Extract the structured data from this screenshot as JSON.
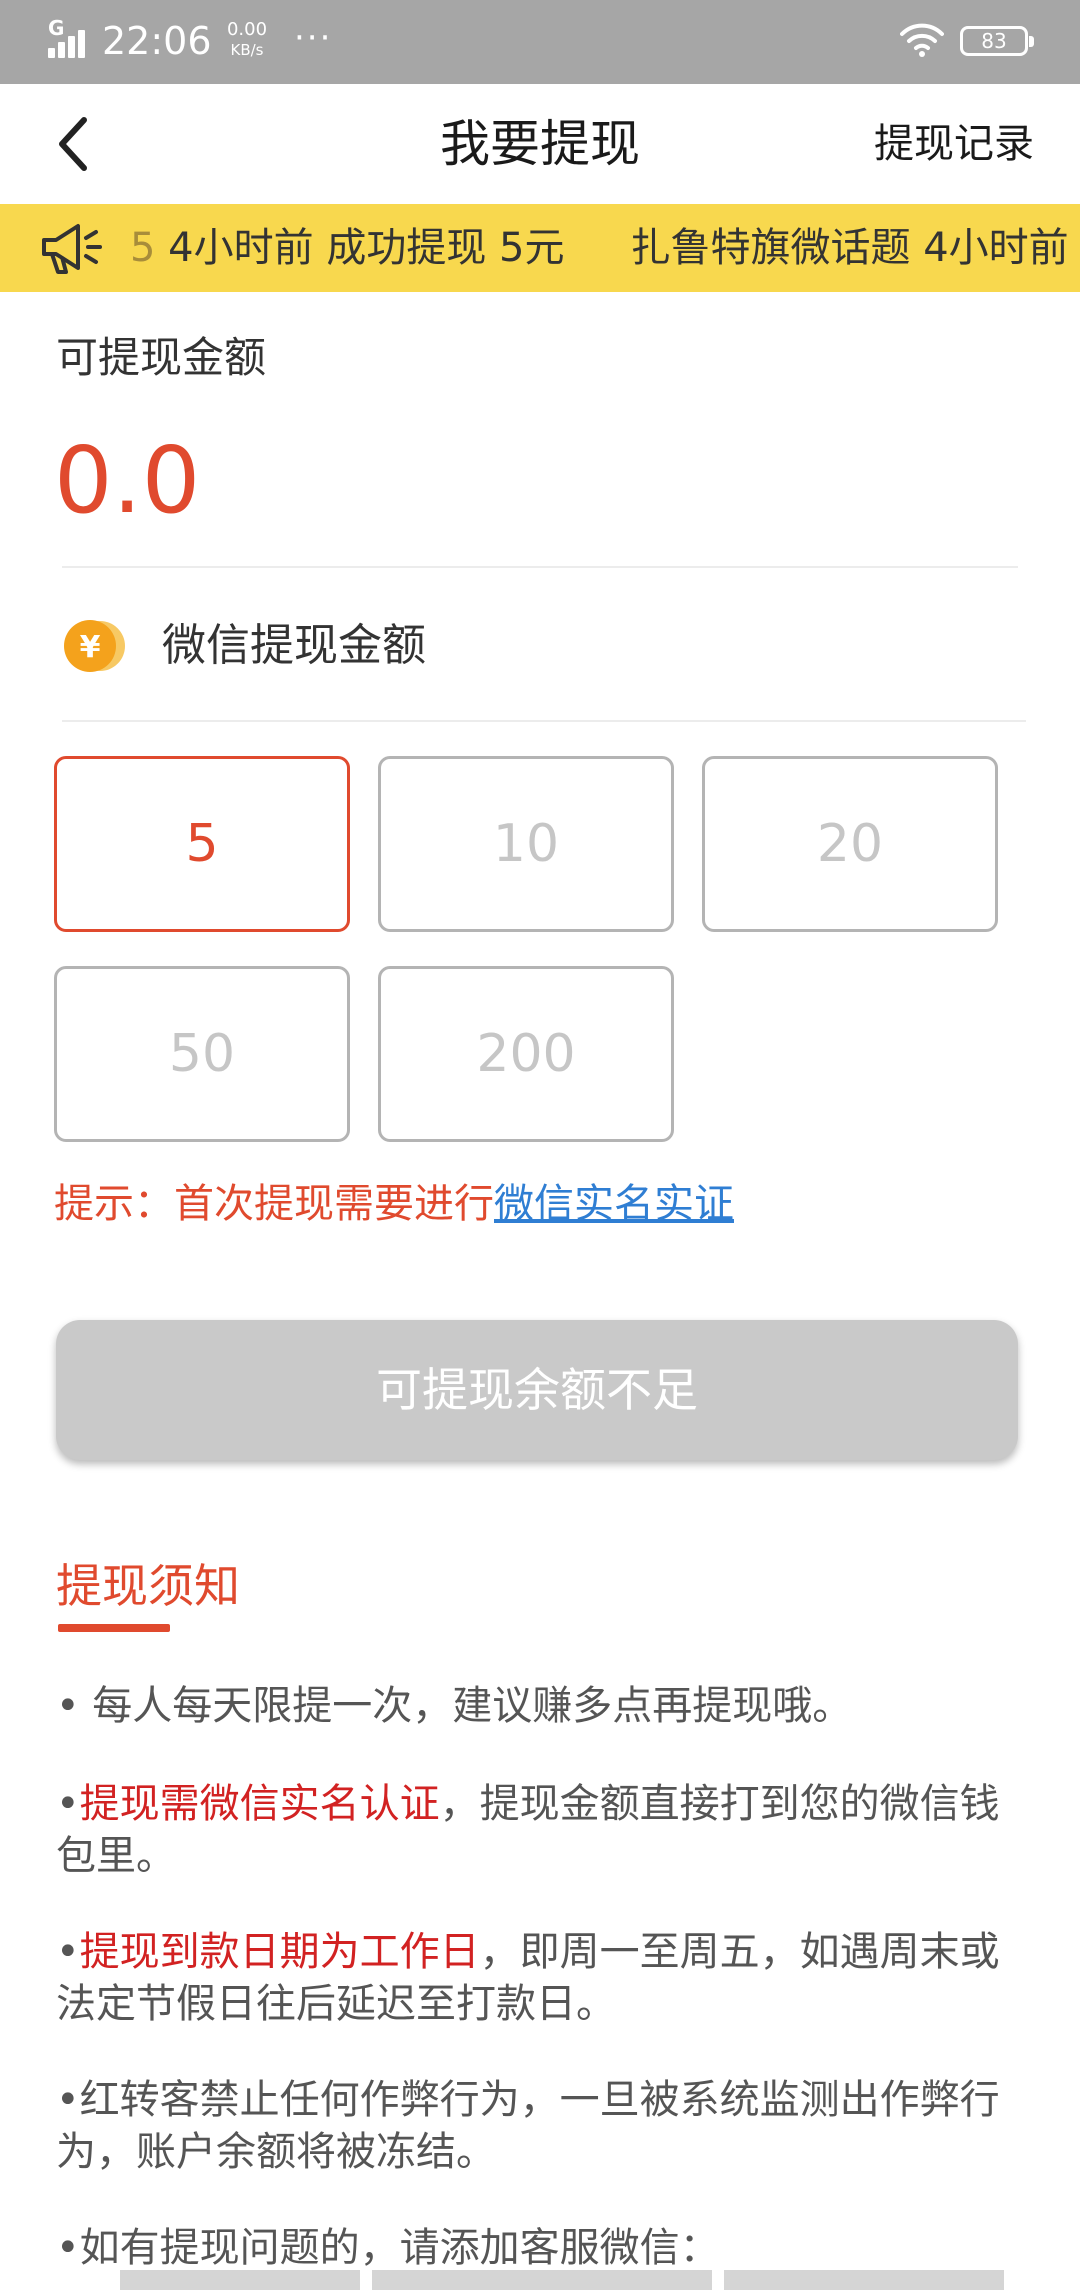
{
  "status_bar": {
    "network": "G",
    "time": "22:06",
    "speed_value": "0.00",
    "speed_unit": "KB/s",
    "more": "···",
    "battery": "83"
  },
  "header": {
    "title": "我要提现",
    "record_link": "提现记录"
  },
  "notice": {
    "faded_prefix": "5",
    "item1": "4小时前 成功提现 5元",
    "item2": "扎鲁特旗微话题 4小时前"
  },
  "balance": {
    "label": "可提现金额",
    "value": "0.0"
  },
  "wechat": {
    "label": "微信提现金额"
  },
  "amount_options": [
    {
      "label": "5",
      "selected": true
    },
    {
      "label": "10",
      "selected": false
    },
    {
      "label": "20",
      "selected": false
    },
    {
      "label": "50",
      "selected": false
    },
    {
      "label": "200",
      "selected": false
    }
  ],
  "tip": {
    "prefix": "提示：首次提现需要进行",
    "link": "微信实名实证"
  },
  "submit_label": "可提现余额不足",
  "rules": {
    "title": "提现须知",
    "p1": "• 每人每天限提一次，建议赚多点再提现哦。",
    "p2_highlight": "提现需微信实名认证",
    "p2_rest": "，提现金额直接打到您的微信钱包里。",
    "p3_highlight": "提现到款日期为工作日",
    "p3_rest": "，即周一至周五，如遇周末或法定节假日往后延迟至打款日。",
    "p4": "•红转客禁止任何作弊行为，一旦被系统监测出作弊行为，账户余额将被冻结。",
    "p5": "•如有提现问题的，请添加客服微信："
  },
  "colors": {
    "accent": "#e04a2e",
    "link": "#2f7ed3",
    "notice_bg": "#f8d84e",
    "status_bar_bg": "#a6a6a6",
    "disabled_button": "#c9c9c9",
    "highlight": "#d22222"
  }
}
